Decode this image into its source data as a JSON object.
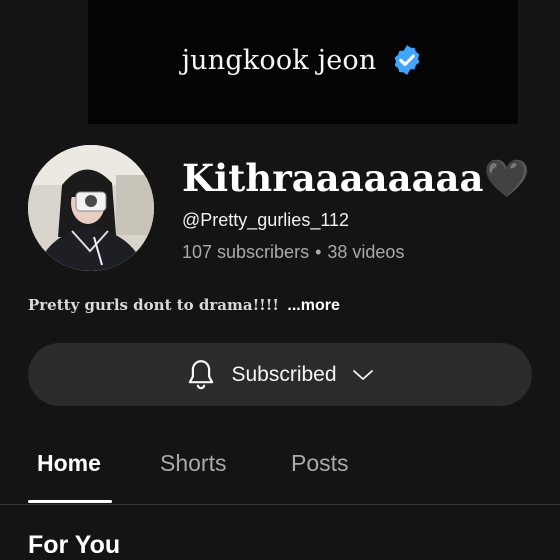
{
  "banner": {
    "title": "jungkook jeon",
    "verified_icon": "verified-badge-icon",
    "badge_color": "#3ea6ff"
  },
  "channel": {
    "name": "Kithraaaaaaaa🖤",
    "handle": "@Pretty_gurlies_112",
    "subscribers": "107 subscribers",
    "separator": "•",
    "videos": "38 videos",
    "description": "Pretty gurls dont to drama!!!!",
    "more_label": "...more"
  },
  "subscribe": {
    "label": "Subscribed",
    "bell_icon": "bell-icon",
    "chevron_icon": "chevron-down-icon"
  },
  "tabs": [
    {
      "label": "Home",
      "active": true
    },
    {
      "label": "Shorts",
      "active": false
    },
    {
      "label": "Posts",
      "active": false
    }
  ],
  "section": {
    "title": "For You"
  }
}
